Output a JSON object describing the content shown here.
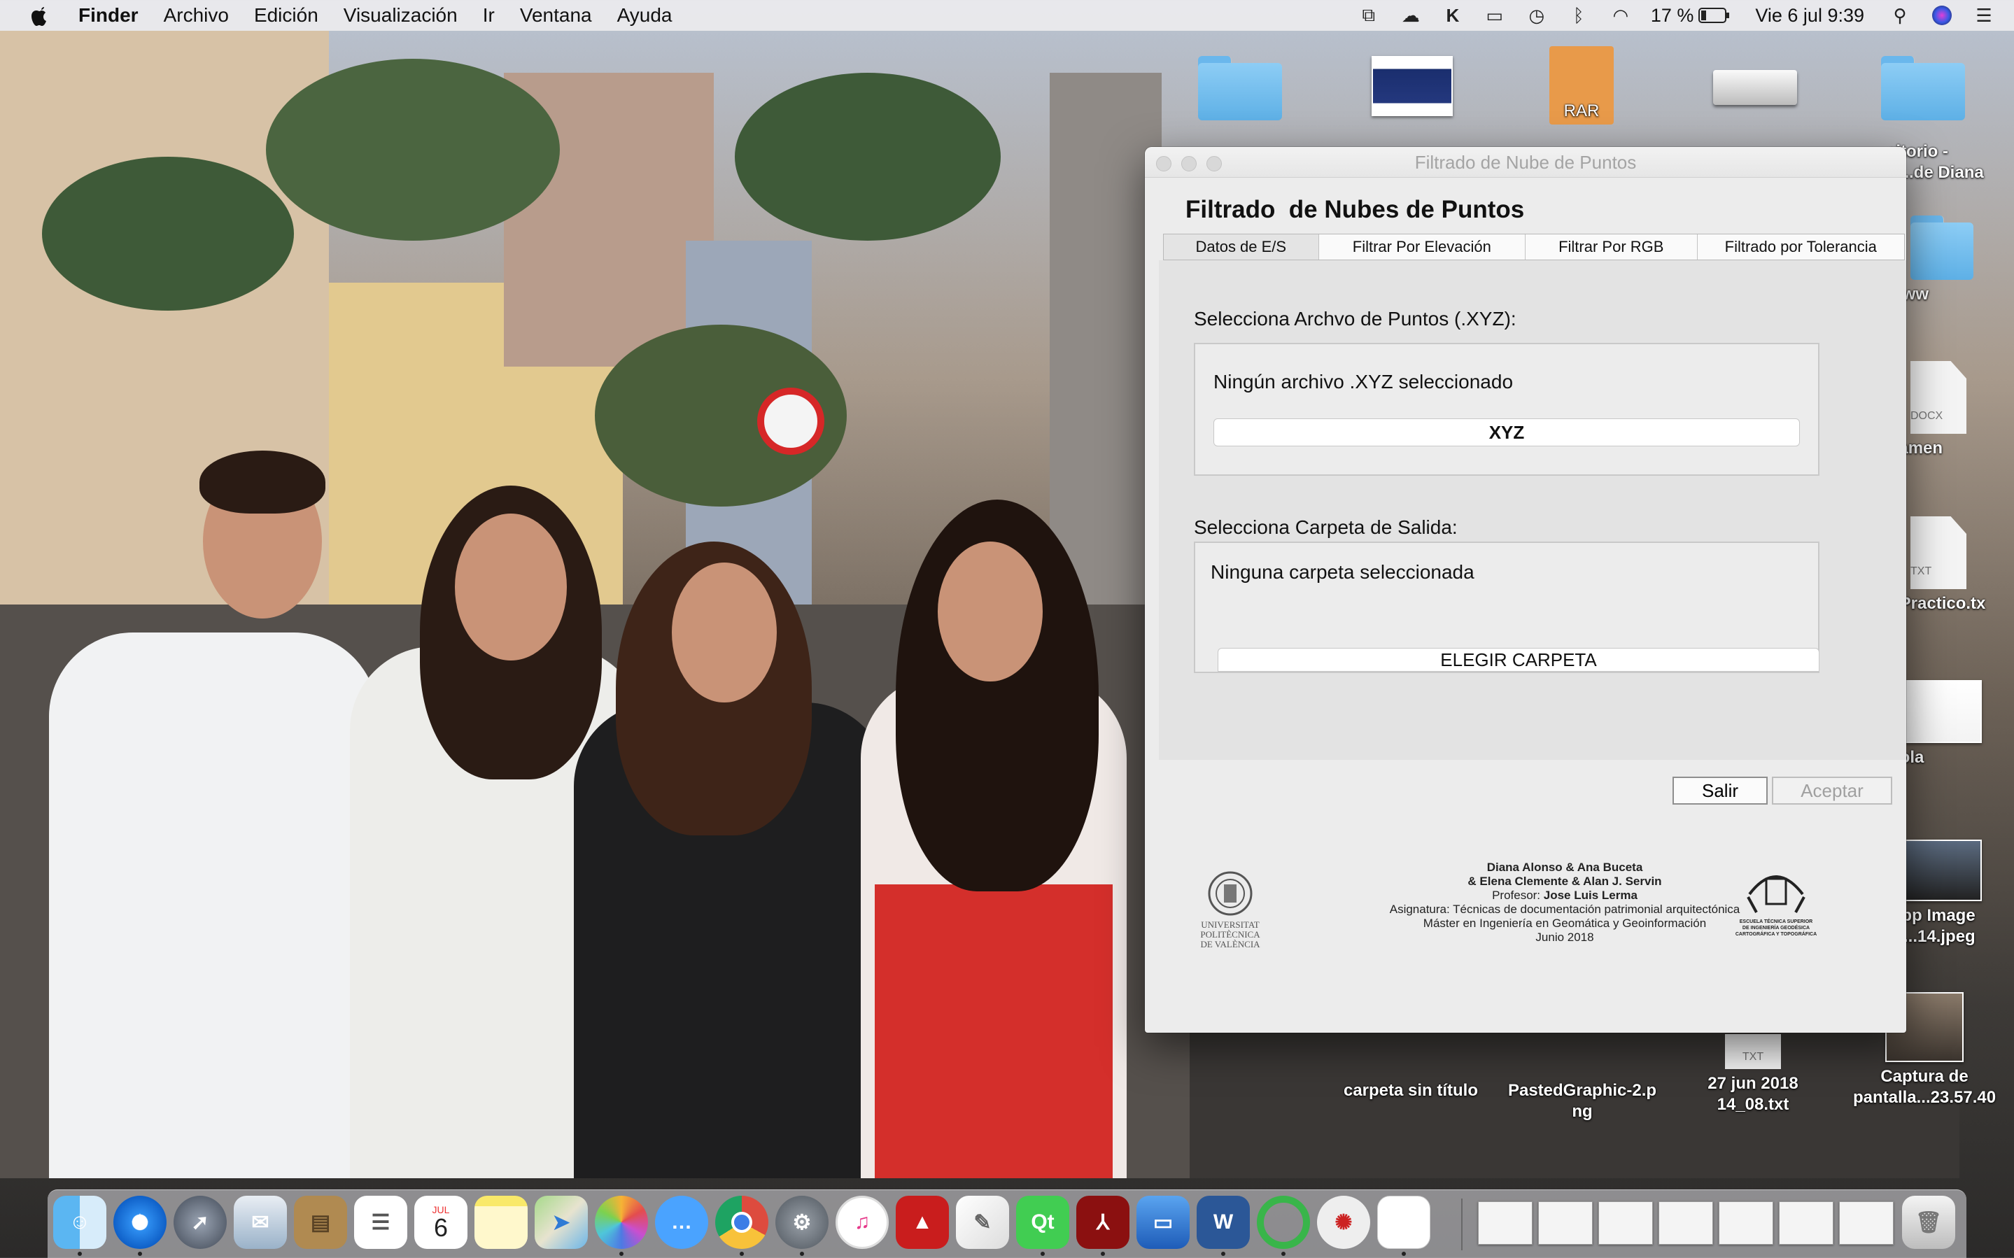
{
  "menubar": {
    "app": "Finder",
    "items": [
      "Archivo",
      "Edición",
      "Visualización",
      "Ir",
      "Ventana",
      "Ayuda"
    ],
    "battery": "17 %",
    "clock": "Vie 6 jul  9:39"
  },
  "desktop": {
    "rar_label": "RAR",
    "items": [
      {
        "label": "ritorio -\no...de Diana"
      },
      {
        "label": "www"
      },
      {
        "label": "kamen",
        "badge": "DOCX"
      },
      {
        "label": "nPractico.tx\nt",
        "badge": "TXT"
      },
      {
        "label": "hola"
      },
      {
        "label": "App Image\n6....14.jpeg"
      },
      {
        "label": "carpeta sin título"
      },
      {
        "label": "PastedGraphic-2.p\nng"
      },
      {
        "label": "27 jun 2018\n14_08.txt",
        "badge": "TXT"
      },
      {
        "label": "Captura de\npantalla...23.57.40"
      }
    ]
  },
  "window": {
    "title": "Filtrado de Nube de Puntos",
    "heading": "Filtrado  de Nubes de Puntos",
    "tabs": [
      "Datos de E/S",
      "Filtrar Por Elevación",
      "Filtrar Por RGB",
      "Filtrado por Tolerancia"
    ],
    "input_group_label": "Selecciona Archvo de Puntos (.XYZ):",
    "input_status": "Ningún archivo .XYZ seleccionado",
    "input_button": "XYZ",
    "output_group_label": "Selecciona Carpeta de Salida:",
    "output_status": "Ninguna carpeta seleccionada",
    "output_button": "ELEGIR CARPETA",
    "exit_button": "Salir",
    "ok_button": "Aceptar",
    "credits": {
      "line1": "Diana Alonso & Ana Buceta",
      "line2": "& Elena Clemente & Alan J. Servin",
      "line3_prefix": "Profesor: ",
      "line3_name": "Jose Luis Lerma",
      "line4": "Asignatura: Técnicas de documentación patrimonial arquitectónica",
      "line5": "Máster en Ingeniería en Geomática y Geoinformación",
      "line6": "Junio 2018"
    },
    "logo_left": "UNIVERSITAT\nPOLITÈCNICA\nDE VALÈNCIA",
    "logo_right": "ESCUELA TÉCNICA SUPERIOR\nDE INGENIERÍA GEODÉSICA\nCARTOGRÁFICA Y TOPOGRÁFICA"
  },
  "dock": {
    "calendar_month": "JUL",
    "calendar_day": "6",
    "apps": [
      "finder-icon",
      "safari-icon",
      "launchpad-icon",
      "mail-icon",
      "contacts-icon",
      "reminders-icon",
      "calendar-icon",
      "notes-icon",
      "maps-icon",
      "photos-icon",
      "messages-icon",
      "chrome-icon",
      "system-preferences-icon",
      "itunes-icon",
      "autocad-icon",
      "textedit-icon",
      "qt-creator-icon",
      "acrobat-icon",
      "keynote-icon",
      "word-icon",
      "progress-icon",
      "spider-icon",
      "document-icon"
    ]
  }
}
